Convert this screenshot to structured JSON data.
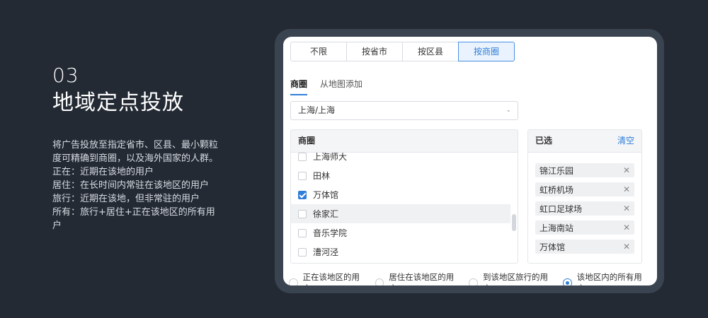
{
  "intro": {
    "number": "03",
    "title": "地域定点投放",
    "description": [
      "将广告投放至指定省市、区县、最小颗粒度可精确到商圈，以及海外国家的人群。",
      "正在：近期在该地的用户",
      "居住：在长时间内常驻在该地区的用户",
      "旅行：近期在该地，但非常驻的用户",
      "所有：旅行+居住+正在该地区的所有用户"
    ]
  },
  "segments": [
    {
      "label": "不限",
      "active": false
    },
    {
      "label": "按省市",
      "active": false
    },
    {
      "label": "按区县",
      "active": false
    },
    {
      "label": "按商圈",
      "active": true
    }
  ],
  "tabs": [
    {
      "label": "商圈",
      "active": true
    },
    {
      "label": "从地图添加",
      "active": false
    }
  ],
  "city_select": {
    "value": "上海/上海",
    "icon": "chevron-down-icon"
  },
  "area_list": {
    "header": "商圈",
    "items": [
      {
        "label": "上海师大",
        "checked": false
      },
      {
        "label": "田林",
        "checked": false
      },
      {
        "label": "万体馆",
        "checked": true
      },
      {
        "label": "徐家汇",
        "checked": false
      },
      {
        "label": "音乐学院",
        "checked": false
      },
      {
        "label": "漕河泾",
        "checked": false
      }
    ]
  },
  "selected": {
    "header": "已选",
    "clear_label": "清空",
    "items": [
      "锦江乐园",
      "虹桥机场",
      "虹口足球场",
      "上海南站",
      "万体馆"
    ]
  },
  "audience": [
    {
      "label": "正在该地区的用户",
      "selected": false
    },
    {
      "label": "居住在该地区的用户",
      "selected": false
    },
    {
      "label": "到该地区旅行的用户",
      "selected": false
    },
    {
      "label": "该地区内的所有用户",
      "selected": true
    }
  ],
  "colors": {
    "background": "#232a34",
    "accent": "#2f7ed8",
    "frame": "#3a4350"
  }
}
